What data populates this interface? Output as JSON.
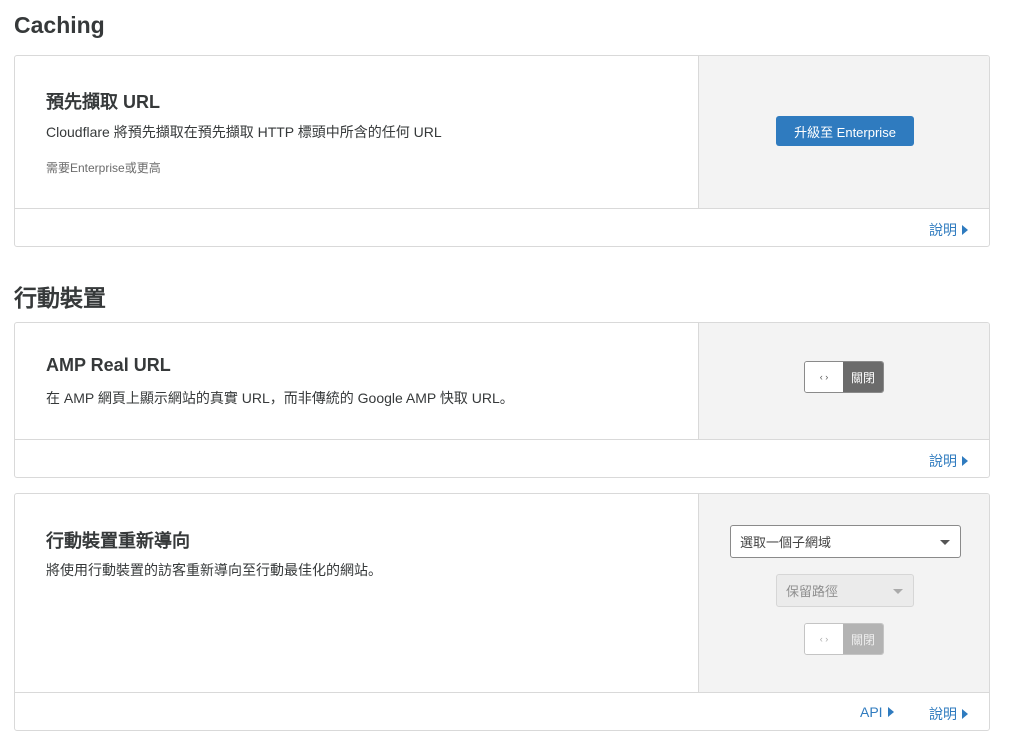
{
  "sections": [
    {
      "title": "Caching",
      "cards": [
        {
          "name": "預先擷取 URL",
          "description": "Cloudflare 將預先擷取在預先擷取 HTTP 標頭中所含的任何 URL",
          "note": "需要Enterprise或更高",
          "upgrade_button": "升級至 Enterprise",
          "help_link": "說明"
        }
      ]
    },
    {
      "title": "行動裝置",
      "cards": [
        {
          "name": "AMP Real URL",
          "description": "在 AMP 網頁上顯示網站的真實 URL，而非傳統的 Google AMP 快取 URL。",
          "toggle_knob": "‹ ›",
          "toggle_state": "關閉",
          "help_link": "說明"
        },
        {
          "name": "行動裝置重新導向",
          "description": "將使用行動裝置的訪客重新導向至行動最佳化的網站。",
          "subdomain_select": "選取一個子網域",
          "path_select": "保留路徑",
          "toggle_knob": "‹ ›",
          "toggle_state": "關閉",
          "api_link": "API",
          "help_link": "說明"
        }
      ]
    }
  ],
  "colors": {
    "accent": "#2f7bbf",
    "panel_bg": "#f3f3f3",
    "border": "#d9d9d9",
    "toggle_off": "#6b6b6b"
  },
  "icons": [
    "toggle-arrows-icon",
    "caret-down-icon",
    "arrow-right-icon"
  ]
}
